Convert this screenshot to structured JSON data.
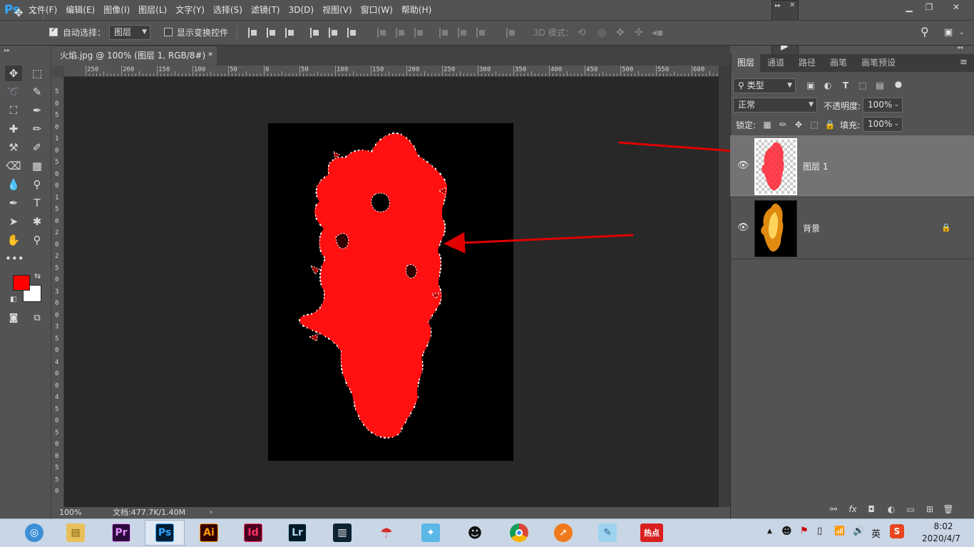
{
  "app": {
    "logo": "Ps"
  },
  "menu": [
    "文件(F)",
    "编辑(E)",
    "图像(I)",
    "图层(L)",
    "文字(Y)",
    "选择(S)",
    "滤镜(T)",
    "3D(D)",
    "视图(V)",
    "窗口(W)",
    "帮助(H)"
  ],
  "options": {
    "auto_select_label": "自动选择：",
    "auto_select_checked": true,
    "auto_select_target": "图层",
    "show_transform_label": "显示变换控件",
    "show_transform_checked": false,
    "mode_3d_label": "3D 模式："
  },
  "document": {
    "tab_title": "火焰.jpg @ 100% (图层 1, RGB/8#) *",
    "zoom": "100%",
    "doc_size": "文档:477.7K/1.40M"
  },
  "rulers": {
    "top": [
      "250",
      "200",
      "150",
      "100",
      "50",
      "0",
      "50",
      "100",
      "150",
      "200",
      "250",
      "300",
      "350",
      "400",
      "450",
      "500",
      "550",
      "600"
    ],
    "left": [
      "5",
      "0",
      "5",
      "0",
      "1",
      "0",
      "5",
      "0",
      "0",
      "1",
      "5",
      "0",
      "2",
      "0",
      "2",
      "5",
      "0",
      "3",
      "0",
      "0",
      "3",
      "5",
      "0",
      "4",
      "0",
      "0",
      "4",
      "5",
      "0",
      "5",
      "0",
      "0",
      "5",
      "5",
      "0"
    ]
  },
  "colors": {
    "foreground": "#ff0000",
    "background": "#ffffff",
    "fire_red": "#ff1111",
    "annotation_arrow": "#e00000"
  },
  "layers_panel": {
    "tabs": [
      "图层",
      "通道",
      "路径",
      "画笔",
      "画笔预设"
    ],
    "active_tab": "图层",
    "filter_kind": "类型",
    "blend_mode": "正常",
    "opacity_label": "不透明度:",
    "opacity_value": "100%",
    "lock_label": "锁定:",
    "fill_label": "填充:",
    "fill_value": "100%",
    "layers": [
      {
        "name": "图层 1",
        "selected": true,
        "locked": false
      },
      {
        "name": "背景",
        "selected": false,
        "locked": true
      }
    ]
  },
  "taskbar": {
    "apps": [
      "windows-start",
      "file-explorer",
      "Pr",
      "Ps",
      "Ai",
      "Id",
      "Lr",
      "video-editor",
      "umbrella-app",
      "bird-app",
      "qq",
      "chrome",
      "fox-app",
      "notepad",
      "热点"
    ],
    "tray_ime": "英",
    "time": "8:02",
    "date": "2020/4/7"
  }
}
